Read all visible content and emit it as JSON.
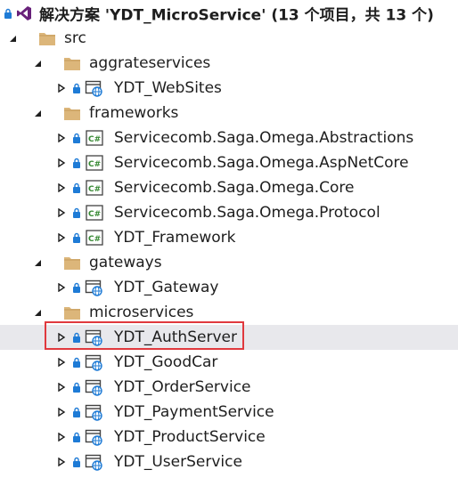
{
  "solution": {
    "label": "解决方案 'YDT_MicroService' (13 个项目，共 13 个)"
  },
  "tree": {
    "src": "src",
    "aggrateservices": "aggrateservices",
    "websites": "YDT_WebSites",
    "frameworks": "frameworks",
    "abstractions": "Servicecomb.Saga.Omega.Abstractions",
    "aspnetcore": "Servicecomb.Saga.Omega.AspNetCore",
    "core": "Servicecomb.Saga.Omega.Core",
    "protocol": "Servicecomb.Saga.Omega.Protocol",
    "framework": "YDT_Framework",
    "gateways": "gateways",
    "gateway": "YDT_Gateway",
    "microservices": "microservices",
    "authserver": "YDT_AuthServer",
    "goodcar": "YDT_GoodCar",
    "orderservice": "YDT_OrderService",
    "paymentservice": "YDT_PaymentService",
    "productservice": "YDT_ProductService",
    "userservice": "YDT_UserService"
  },
  "icons": {
    "expanded": "triangle-down-icon",
    "collapsed": "triangle-right-icon",
    "folder": "folder-icon",
    "lock": "lock-icon",
    "web_project": "web-project-icon",
    "csharp_project": "csharp-project-icon",
    "solution": "visual-studio-icon"
  },
  "colors": {
    "folder": "#dcb67a",
    "lock": "#1e7bd6",
    "csharp": "#388a34",
    "globe": "#1e7bd6",
    "selection_border": "#e0393e",
    "vs_purple": "#68217a"
  }
}
